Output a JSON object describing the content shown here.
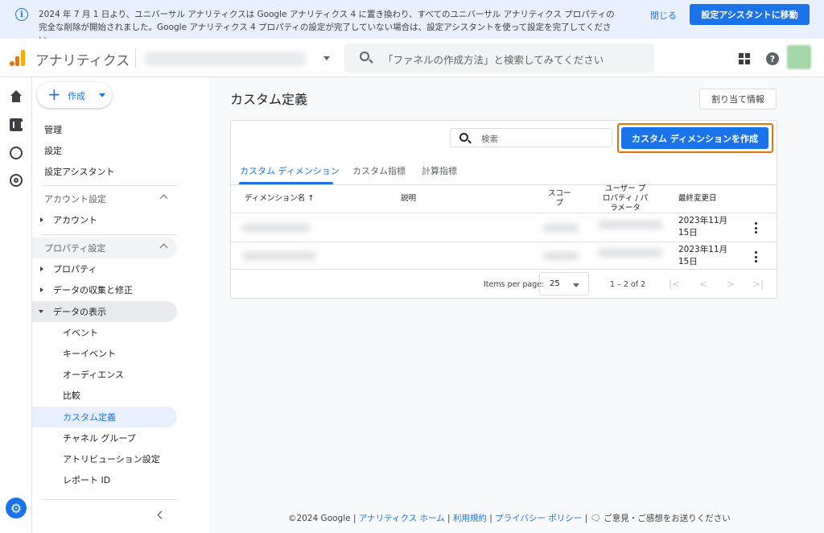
{
  "banner": {
    "message": "2024 年 7 月 1 日より、ユニバーサル アナリティクスは Google アナリティクス 4 に置き換わり、すべてのユニバーサル アナリティクス プロパティの完全な削除が開始されました。Google アナリティクス 4 プロパティの設定が完了していない場合は、設定アシスタントを使って設定を完了してください。",
    "close_label": "閉じる",
    "assistant_button": "設定アシスタントに移動"
  },
  "header": {
    "app_name": "アナリティクス",
    "search_placeholder": "「ファネルの作成方法」と検索してみてください",
    "help_glyph": "?"
  },
  "sidebar": {
    "create_label": "作成",
    "top_items": [
      "管理",
      "設定",
      "設定アシスタント"
    ],
    "account_section": "アカウント設定",
    "account_item": "アカウント",
    "property_section": "プロパティ設定",
    "property_item": "プロパティ",
    "data_collection_item": "データの収集と修正",
    "data_display_item": "データの表示",
    "data_display_children": [
      "イベント",
      "キーイベント",
      "オーディエンス",
      "比較",
      "カスタム定義",
      "チャネル グループ",
      "アトリビューション設定",
      "レポート ID"
    ]
  },
  "main": {
    "title": "カスタム定義",
    "assign_button": "割り当て情報",
    "search_placeholder": "検索",
    "create_button": "カスタム ディメンションを作成",
    "tabs": [
      "カスタム ディメンション",
      "カスタム指標",
      "計算指標"
    ],
    "columns": {
      "name": "ディメンション名 ↑",
      "description": "説明",
      "scope": "スコー\nプ",
      "user_property": "ユーザー プ\nロパティ / パ\nラメータ",
      "last_modified": "最終変更日"
    },
    "rows": [
      {
        "date_line1": "2023年11月",
        "date_line2": "15日"
      },
      {
        "date_line1": "2023年11月",
        "date_line2": "15日"
      }
    ],
    "pagination": {
      "items_per_page_label": "Items per page:",
      "items_per_page_value": "25",
      "range": "1 – 2 of 2",
      "first": "|<",
      "prev": "<",
      "next": ">",
      "last": ">|"
    }
  },
  "footer": {
    "copyright": "©2024 Google",
    "sep": "|",
    "link_home": "アナリティクス ホーム",
    "link_terms": "利用規約",
    "link_privacy": "プライバシー ポリシー",
    "feedback": "ご意見・ご感想をお送りください"
  },
  "colors": {
    "accent": "#1a73e8",
    "highlight_border": "#e8710a"
  }
}
